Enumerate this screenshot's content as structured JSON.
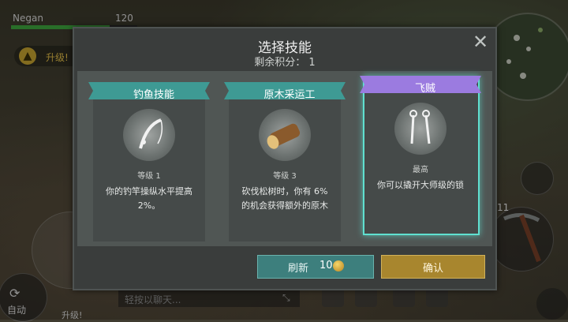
{
  "hud": {
    "player_name": "Negan",
    "hp_value": "120",
    "upgrade_label": "升级!",
    "auto_label": "自动",
    "tool_count": "11",
    "chat_placeholder": "轻按以聊天...",
    "bottom_upgrade_label": "升级!"
  },
  "modal": {
    "title": "选择技能",
    "points_line": "剩余积分： 1",
    "refresh_label": "刷新",
    "refresh_cost": "10",
    "confirm_label": "确认"
  },
  "cards": [
    {
      "title": "钓鱼技能",
      "level": "等级 1",
      "desc": "你的钓竿操纵水平提高 2%。",
      "icon": "fishing-rod-icon",
      "ribbon_color": "#3e9a94"
    },
    {
      "title": "原木采运工",
      "level": "等级 3",
      "desc": "砍伐松树时，你有 6% 的机会获得额外的原木",
      "icon": "log-icon",
      "ribbon_color": "#3e9a94"
    },
    {
      "title": "飞贼",
      "level": "最高",
      "desc": "你可以撬开大师级的锁",
      "icon": "lockpick-icon",
      "ribbon_color": "#9b7be0"
    }
  ],
  "colors": {
    "accent_teal": "#3e9a94",
    "accent_purple": "#9b7be0",
    "confirm_gold": "#a8862e"
  }
}
